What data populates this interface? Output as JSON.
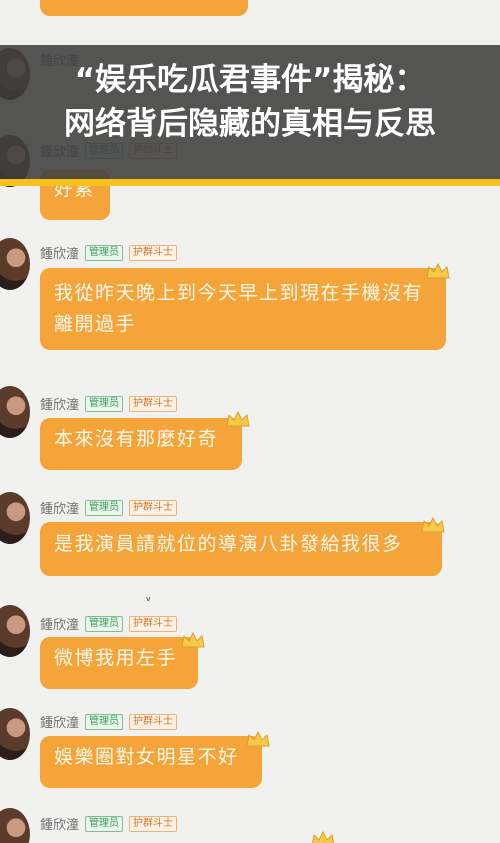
{
  "banner": {
    "title_line1": "“娱乐吃瓜君事件”揭秘：",
    "title_line2": "网络背后隐藏的真相与反思"
  },
  "sender": {
    "name": "鍾欣潼",
    "badge_admin": "管理员",
    "badge_guard": "护群斗士"
  },
  "messages": [
    {
      "text": "好累"
    },
    {
      "text": "我從昨天晚上到今天早上到現在手機沒有離開過手"
    },
    {
      "text": "本來沒有那麼好奇"
    },
    {
      "text": "是我演員請就位的導演八卦發給我很多"
    },
    {
      "text": "微博我用左手"
    },
    {
      "text": "娛樂圈對女明星不好"
    }
  ],
  "colors": {
    "bubble": "#f5a43a",
    "banner_stripe": "#f7c21d",
    "background": "#f1f1ef"
  },
  "icons": [
    "crown-icon",
    "avatar"
  ]
}
